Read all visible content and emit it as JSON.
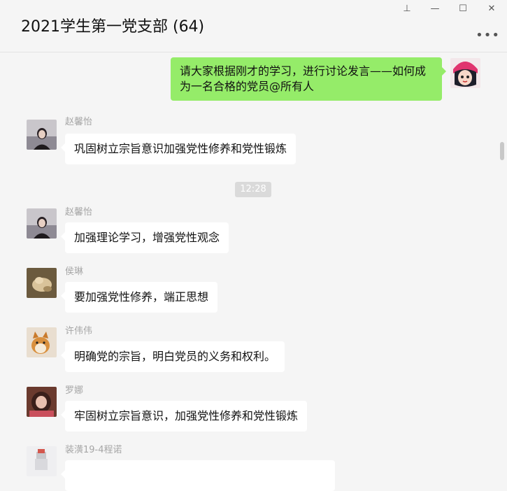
{
  "window": {
    "title": "2021学生第一党支部 (64)",
    "controls": {
      "pin": "⊥",
      "minimize": "—",
      "maximize": "☐",
      "close": "✕"
    },
    "more": "•••"
  },
  "self_message": {
    "text": "请大家根据刚才的学习，进行讨论发言——如何成为一名合格的党员@所有人"
  },
  "timestamp": "12:28",
  "messages": [
    {
      "sender": "赵馨怡",
      "text": "巩固树立宗旨意识加强党性修养和党性锻炼"
    },
    {
      "sender": "赵馨怡",
      "text": "加强理论学习，增强党性观念"
    },
    {
      "sender": "侯琳",
      "text": "要加强党性修养，端正思想"
    },
    {
      "sender": "许伟伟",
      "text": "明确党的宗旨，明白党员的义务和权利。"
    },
    {
      "sender": "罗娜",
      "text": "牢固树立宗旨意识，加强党性修养和党性锻炼"
    },
    {
      "sender": "装潢19-4程诺",
      "text": ""
    }
  ],
  "colors": {
    "self_bubble": "#95ec69",
    "other_bubble": "#ffffff",
    "background": "#f5f5f5"
  }
}
